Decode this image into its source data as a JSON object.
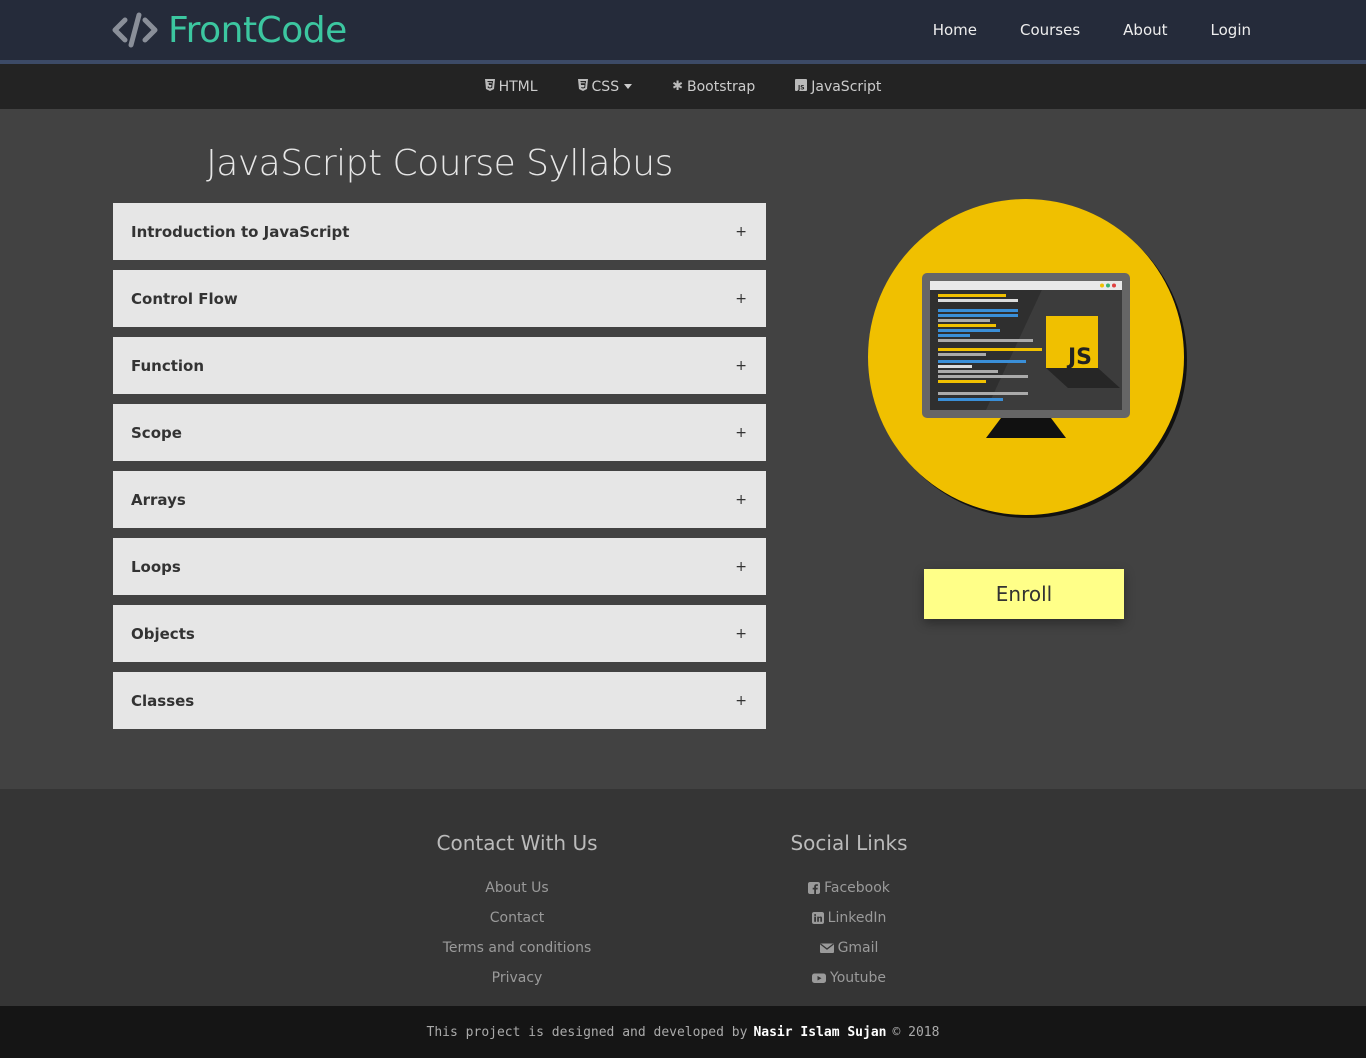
{
  "brand": {
    "name": "FrontCode",
    "color": "#3cc7a0"
  },
  "nav": {
    "home": "Home",
    "courses": "Courses",
    "about": "About",
    "login": "Login"
  },
  "subnav": {
    "html": "HTML",
    "css": "CSS",
    "bootstrap": "Bootstrap",
    "javascript": "JavaScript"
  },
  "main": {
    "title": "JavaScript Course Syllabus",
    "items": [
      {
        "label": "Introduction to JavaScript",
        "toggle": "+"
      },
      {
        "label": "Control Flow",
        "toggle": "+"
      },
      {
        "label": "Function",
        "toggle": "+"
      },
      {
        "label": "Scope",
        "toggle": "+"
      },
      {
        "label": "Arrays",
        "toggle": "+"
      },
      {
        "label": "Loops",
        "toggle": "+"
      },
      {
        "label": "Objects",
        "toggle": "+"
      },
      {
        "label": "Classes",
        "toggle": "+"
      }
    ],
    "badge_text": "JS",
    "enroll_label": "Enroll"
  },
  "footer": {
    "contact_heading": "Contact With Us",
    "contact_links": [
      "About Us",
      "Contact",
      "Terms and conditions",
      "Privacy"
    ],
    "social_heading": "Social Links",
    "social_links": [
      {
        "label": "Facebook",
        "icon": "facebook-icon"
      },
      {
        "label": "LinkedIn",
        "icon": "linkedin-icon"
      },
      {
        "label": "Gmail",
        "icon": "envelope-icon"
      },
      {
        "label": "Youtube",
        "icon": "youtube-icon"
      }
    ],
    "copyright_prefix": "This project is designed and developed by",
    "author": "Nasir Islam Sujan",
    "copyright_suffix": "© 2018"
  }
}
